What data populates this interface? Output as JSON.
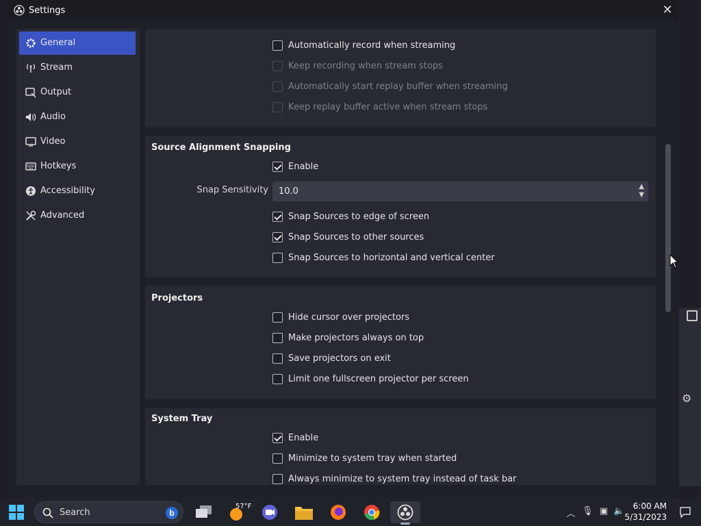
{
  "window": {
    "title": "Settings",
    "close_glyph": "✕"
  },
  "sidebar": {
    "items": [
      {
        "label": "General",
        "icon": "gear-icon",
        "active": true
      },
      {
        "label": "Stream",
        "icon": "antenna-icon"
      },
      {
        "label": "Output",
        "icon": "output-icon"
      },
      {
        "label": "Audio",
        "icon": "speaker-icon"
      },
      {
        "label": "Video",
        "icon": "monitor-icon"
      },
      {
        "label": "Hotkeys",
        "icon": "keyboard-icon"
      },
      {
        "label": "Accessibility",
        "icon": "accessibility-icon"
      },
      {
        "label": "Advanced",
        "icon": "tools-icon"
      }
    ]
  },
  "output_group": {
    "items": [
      {
        "label": "Automatically record when streaming",
        "checked": false,
        "disabled": false
      },
      {
        "label": "Keep recording when stream stops",
        "checked": false,
        "disabled": true
      },
      {
        "label": "Automatically start replay buffer when streaming",
        "checked": false,
        "disabled": true
      },
      {
        "label": "Keep replay buffer active when stream stops",
        "checked": false,
        "disabled": true
      }
    ]
  },
  "snapping": {
    "title": "Source Alignment Snapping",
    "enable_label": "Enable",
    "enable_checked": true,
    "sensitivity_label": "Snap Sensitivity",
    "sensitivity_value": "10.0",
    "items": [
      {
        "label": "Snap Sources to edge of screen",
        "checked": true
      },
      {
        "label": "Snap Sources to other sources",
        "checked": true
      },
      {
        "label": "Snap Sources to horizontal and vertical center",
        "checked": false
      }
    ]
  },
  "projectors": {
    "title": "Projectors",
    "items": [
      {
        "label": "Hide cursor over projectors",
        "checked": false
      },
      {
        "label": "Make projectors always on top",
        "checked": false
      },
      {
        "label": "Save projectors on exit",
        "checked": false
      },
      {
        "label": "Limit one fullscreen projector per screen",
        "checked": false
      }
    ]
  },
  "system_tray": {
    "title": "System Tray",
    "items": [
      {
        "label": "Enable",
        "checked": true
      },
      {
        "label": "Minimize to system tray when started",
        "checked": false
      },
      {
        "label": "Always minimize to system tray instead of task bar",
        "checked": false
      }
    ]
  },
  "taskbar": {
    "search_label": "Search",
    "weather_temp": "57°F",
    "time": "6:00 AM",
    "date": "5/31/2023",
    "apps": [
      "start-icon",
      "task-view-icon",
      "weather-icon",
      "chat-icon",
      "file-explorer-icon",
      "firefox-icon",
      "chrome-icon",
      "obs-icon"
    ]
  },
  "colors": {
    "accent": "#3b54c4",
    "panel": "#272a33",
    "window": "#1e2028"
  }
}
